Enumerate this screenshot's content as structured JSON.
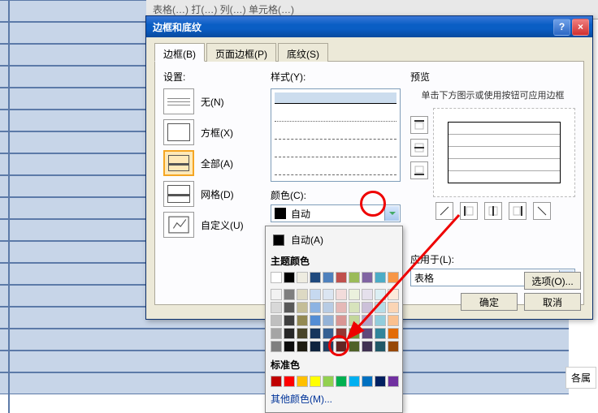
{
  "top_toolbar": "表格(…)     打(…)     列(…)     单元格(…)",
  "dialog": {
    "title": "边框和底纹",
    "help_icon": "?",
    "close_icon": "×",
    "tabs": {
      "border": "边框(B)",
      "page_border": "页面边框(P)",
      "shading": "底纹(S)"
    },
    "settings": {
      "label": "设置:",
      "none": "无(N)",
      "box": "方框(X)",
      "all": "全部(A)",
      "grid": "网格(D)",
      "custom": "自定义(U)"
    },
    "style": {
      "label": "样式(Y):",
      "color_label": "颜色(C):",
      "color_value": "自动"
    },
    "preview": {
      "label": "预览",
      "hint": "单击下方图示或使用按钮可应用边框",
      "apply_label": "应用于(L):",
      "apply_value": "表格",
      "options": "选项(O)..."
    },
    "buttons": {
      "ok": "确定",
      "cancel": "取消"
    }
  },
  "color_popup": {
    "auto": "自动(A)",
    "theme": "主题颜色",
    "theme_colors_row1": [
      "#ffffff",
      "#000000",
      "#eeece1",
      "#1f497d",
      "#4f81bd",
      "#c0504d",
      "#9bbb59",
      "#8064a2",
      "#4bacc6",
      "#f79646"
    ],
    "theme_shades": [
      [
        "#f2f2f2",
        "#7f7f7f",
        "#ddd9c3",
        "#c6d9f0",
        "#dbe5f1",
        "#f2dcdb",
        "#ebf1dd",
        "#e5e0ec",
        "#dbeef3",
        "#fdeada"
      ],
      [
        "#d8d8d8",
        "#595959",
        "#c4bd97",
        "#8db3e2",
        "#b8cce4",
        "#e5b9b7",
        "#d7e3bc",
        "#ccc1d9",
        "#b7dde8",
        "#fbd5b5"
      ],
      [
        "#bfbfbf",
        "#3f3f3f",
        "#938953",
        "#548dd4",
        "#95b3d7",
        "#d99694",
        "#c3d69b",
        "#b2a2c7",
        "#92cddc",
        "#fac08f"
      ],
      [
        "#a5a5a5",
        "#262626",
        "#494429",
        "#17365d",
        "#366092",
        "#953734",
        "#76923c",
        "#5f497a",
        "#31859b",
        "#e36c09"
      ],
      [
        "#7f7f7f",
        "#0c0c0c",
        "#1d1b10",
        "#0f243e",
        "#244061",
        "#632423",
        "#4f6128",
        "#3f3151",
        "#205867",
        "#974806"
      ]
    ],
    "standard": "标准色",
    "standard_colors": [
      "#c00000",
      "#ff0000",
      "#ffc000",
      "#ffff00",
      "#92d050",
      "#00b050",
      "#00b0f0",
      "#0070c0",
      "#002060",
      "#7030a0"
    ],
    "more": "其他颜色(M)..."
  },
  "corner_label": "各属"
}
